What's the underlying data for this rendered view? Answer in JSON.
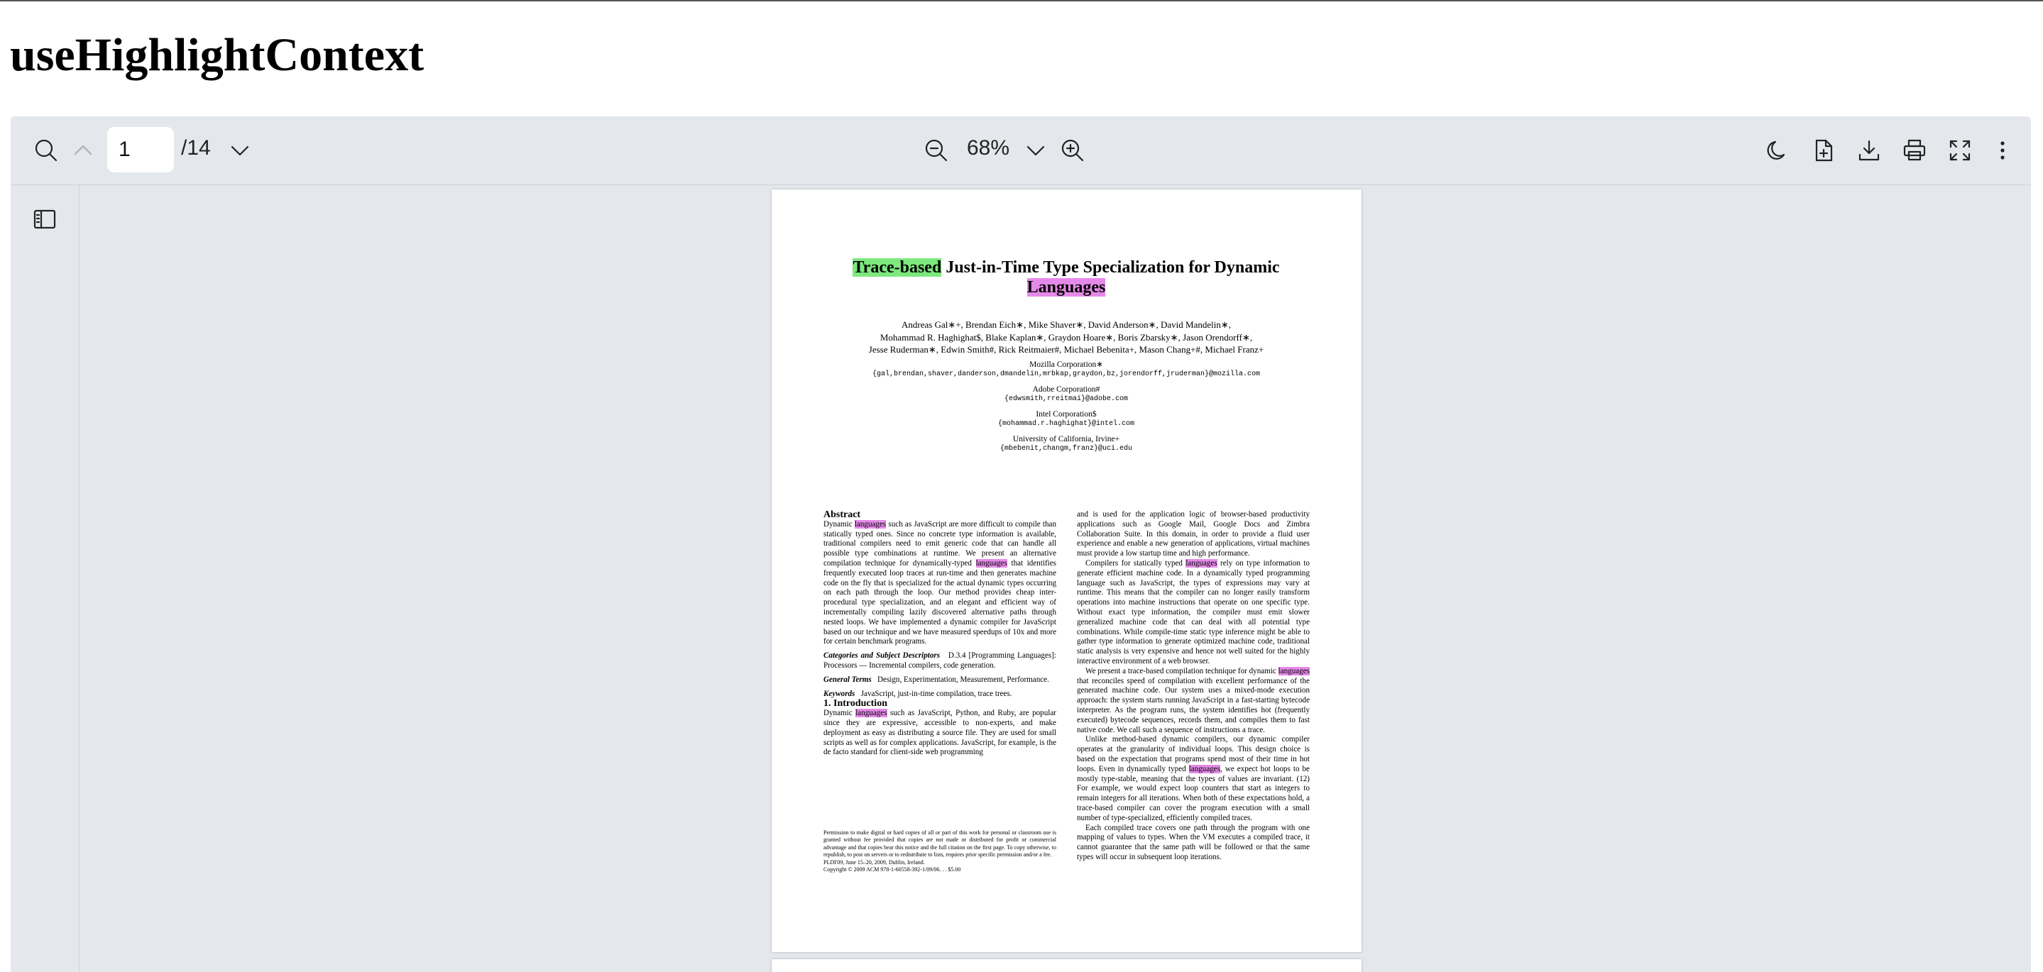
{
  "page": {
    "heading": "useHighlightContext"
  },
  "toolbar": {
    "page_current": "1",
    "page_total": "/14",
    "zoom": "68%",
    "icons": [
      "search-icon",
      "chevron-up-icon",
      "chevron-down-icon",
      "zoom-out-icon",
      "zoom-in-icon",
      "moon-icon",
      "open-file-icon",
      "download-icon",
      "print-icon",
      "fullscreen-icon",
      "more-vertical-icon",
      "sidebar-toggle-icon"
    ]
  },
  "highlight_colors": {
    "trace_based": "#7de87d",
    "languages": "#e58ae8"
  },
  "paper": {
    "title_hl1": "Trace-based",
    "title_mid": " Just-in-Time Type Specialization for Dynamic ",
    "title_hl2": "Languages",
    "authors_line1": "Andreas Gal∗+, Brendan Eich∗, Mike Shaver∗, David Anderson∗, David Mandelin∗,",
    "authors_line2": "Mohammad R. Haghighat$, Blake Kaplan∗, Graydon Hoare∗, Boris Zbarsky∗, Jason Orendorff∗,",
    "authors_line3": "Jesse Ruderman∗, Edwin Smith#, Rick Reitmaier#, Michael Bebenita+, Mason Chang+#, Michael Franz+",
    "affiliations": [
      {
        "name": "Mozilla Corporation∗",
        "email": "{gal,brendan,shaver,danderson,dmandelin,mrbkap,graydon,bz,jorendorff,jruderman}@mozilla.com"
      },
      {
        "name": "Adobe Corporation#",
        "email": "{edwsmith,rreitmai}@adobe.com"
      },
      {
        "name": "Intel Corporation$",
        "email": "{mohammad.r.haghighat}@intel.com"
      },
      {
        "name": "University of California, Irvine+",
        "email": "{mbebenit,changm,franz}@uci.edu"
      }
    ],
    "abstract_heading": "Abstract",
    "abs_a": "Dynamic ",
    "abs_hl1": "languages",
    "abs_b": " such as JavaScript are more difficult to compile than statically typed ones. Since no concrete type information is available, traditional compilers need to emit generic code that can handle all possible type combinations at runtime. We present an alternative compilation technique for dynamically-typed ",
    "abs_hl2": "languages",
    "abs_c": " that identifies frequently executed loop traces at run-time and then generates machine code on the fly that is specialized for the actual dynamic types occurring on each path through the loop. Our method provides cheap inter-procedural type specialization, and an elegant and efficient way of incrementally compiling lazily discovered alternative paths through nested loops. We have implemented a dynamic compiler for JavaScript based on our technique and we have measured speedups of 10x and more for certain benchmark programs.",
    "cat_label": "Categories and Subject Descriptors",
    "cat_text": "D.3.4 [Programming Languages]: Processors — Incremental compilers, code generation.",
    "gen_label": "General Terms",
    "gen_text": "Design, Experimentation, Measurement, Performance.",
    "kw_label": "Keywords",
    "kw_text": "JavaScript, just-in-time compilation, trace trees.",
    "intro_heading": "1.   Introduction",
    "intro_a": "Dynamic ",
    "intro_hl": "languages",
    "intro_b": " such as JavaScript, Python, and Ruby, are popular since they are expressive, accessible to non-experts, and make deployment as easy as distributing a source file. They are used for small scripts as well as for complex applications. JavaScript, for example, is the de facto standard for client-side web programming",
    "perm_text": "Permission to make digital or hard copies of all or part of this work for personal or classroom use is granted without fee provided that copies are not made or distributed for profit or commercial advantage and that copies bear this notice and the full citation on the first page. To copy otherwise, to republish, to post on servers or to redistribute to lists, requires prior specific permission and/or a fee.",
    "perm_conf": "PLDI'09,   June 15–20, 2009, Dublin, Ireland.",
    "perm_copy": "Copyright © 2009 ACM 978-1-60558-392-1/09/06. . . $5.00",
    "r1": "and is used for the application logic of browser-based productivity applications such as Google Mail, Google Docs and Zimbra Collaboration Suite. In this domain, in order to provide a fluid user experience and enable a new generation of applications, virtual machines must provide a low startup time and high performance.",
    "r2_a": "Compilers for statically typed ",
    "r2_hl": "languages",
    "r2_b": " rely on type information to generate efficient machine code. In a dynamically typed programming language such as JavaScript, the types of expressions may vary at runtime. This means that the compiler can no longer easily transform operations into machine instructions that operate on one specific type. Without exact type information, the compiler must emit slower generalized machine code that can deal with all potential type combinations. While compile-time static type inference might be able to gather type information to generate optimized machine code, traditional static analysis is very expensive and hence not well suited for the highly interactive environment of a web browser.",
    "r3_a": "We present a trace-based compilation technique for dynamic ",
    "r3_hl": "languages",
    "r3_b": " that reconciles speed of compilation with excellent performance of the generated machine code. Our system uses a mixed-mode execution approach: the system starts running JavaScript in a fast-starting bytecode interpreter. As the program runs, the system identifies hot (frequently executed) bytecode sequences, records them, and compiles them to fast native code. We call such a sequence of instructions a trace.",
    "r4_a": "Unlike method-based dynamic compilers, our dynamic compiler operates at the granularity of individual loops. This design choice is based on the expectation that programs spend most of their time in hot loops. Even in dynamically typed ",
    "r4_hl": "languages",
    "r4_b": ", we expect hot loops to be mostly type-stable, meaning that the types of values are invariant. (12) For example, we would expect loop counters that start as integers to remain integers for all iterations. When both of these expectations hold, a trace-based compiler can cover the program execution with a small number of type-specialized, efficiently compiled traces.",
    "r5": "Each compiled trace covers one path through the program with one mapping of values to types. When the VM executes a compiled trace, it cannot guarantee that the same path will be followed or that the same types will occur in subsequent loop iterations."
  }
}
